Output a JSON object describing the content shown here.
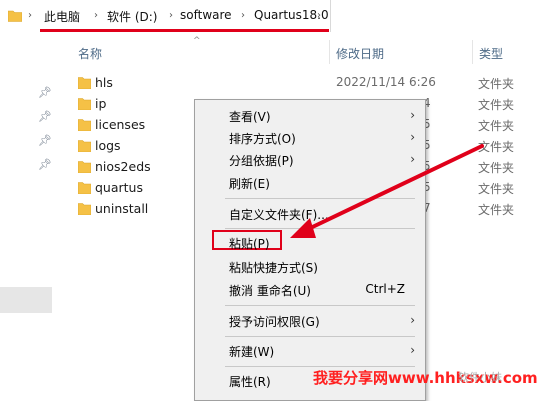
{
  "breadcrumb": [
    "此电脑",
    "软件 (D:)",
    "software",
    "Quartus18.0"
  ],
  "columns": {
    "name": "名称",
    "date": "修改日期",
    "type": "类型"
  },
  "files": [
    {
      "name": "hls",
      "date": "2022/11/14 6:26",
      "partial": "",
      "type": "文件夹"
    },
    {
      "name": "ip",
      "date": "",
      "partial": "4",
      "type": "文件夹"
    },
    {
      "name": "licenses",
      "date": "",
      "partial": "5",
      "type": "文件夹"
    },
    {
      "name": "logs",
      "date": "",
      "partial": "5",
      "type": "文件夹"
    },
    {
      "name": "nios2eds",
      "date": "",
      "partial": "5",
      "type": "文件夹"
    },
    {
      "name": "quartus",
      "date": "",
      "partial": "5",
      "type": "文件夹"
    },
    {
      "name": "uninstall",
      "date": "",
      "partial": "7",
      "type": "文件夹"
    }
  ],
  "context_menu": {
    "view": "查看(V)",
    "sort": "排序方式(O)",
    "group": "分组依据(P)",
    "refresh": "刷新(E)",
    "customize": "自定义文件夹(F)...",
    "paste": "粘贴(P)",
    "paste_shortcut": "粘贴快捷方式(S)",
    "undo_rename": "撤消 重命名(U)",
    "undo_shortcut": "Ctrl+Z",
    "grant_access": "授予访问权限(G)",
    "new": "新建(W)",
    "properties": "属性(R)"
  },
  "watermark": "我要分享网www.hhksxw.com",
  "watermark_tail": "软件小妹",
  "colors": {
    "annotation": "#e0001a",
    "folder": "#f5c146"
  }
}
